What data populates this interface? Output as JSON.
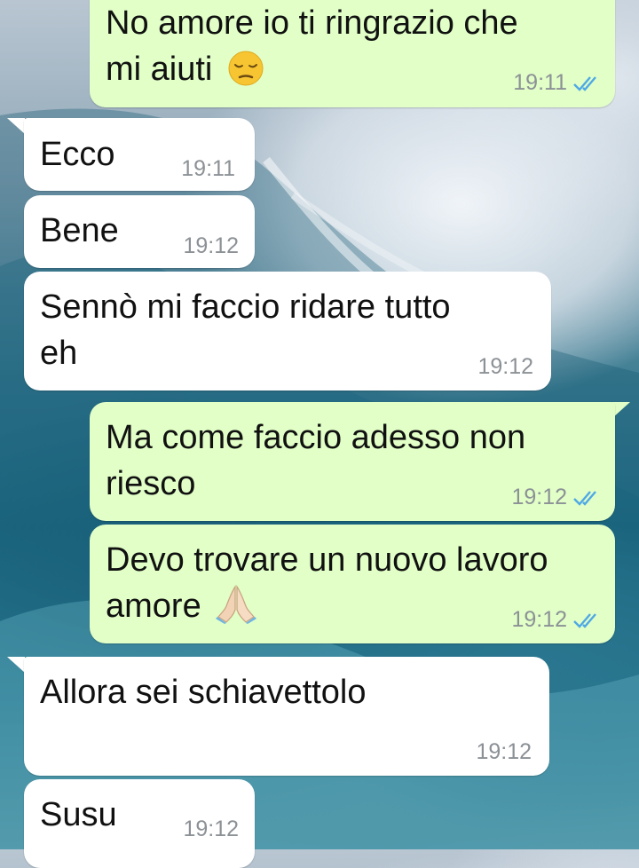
{
  "conversation": {
    "messages": [
      {
        "direction": "outgoing",
        "lines": [
          "No amore io ti ringrazio che",
          "mi aiuti"
        ],
        "emoji": "pensive-face-emoji",
        "time": "19:11",
        "status": "read"
      },
      {
        "direction": "incoming",
        "lines": [
          "Ecco"
        ],
        "time": "19:11"
      },
      {
        "direction": "incoming",
        "lines": [
          "Bene"
        ],
        "time": "19:12"
      },
      {
        "direction": "incoming",
        "lines": [
          "Sennò mi faccio ridare tutto",
          "eh"
        ],
        "time": "19:12"
      },
      {
        "direction": "outgoing",
        "lines": [
          "Ma come faccio adesso non",
          "riesco"
        ],
        "time": "19:12",
        "status": "read"
      },
      {
        "direction": "outgoing",
        "lines": [
          "Devo trovare un nuovo lavoro",
          "amore"
        ],
        "emoji": "folded-hands-emoji",
        "time": "19:12",
        "status": "read"
      },
      {
        "direction": "incoming",
        "lines": [
          "Allora sei schiavettolo"
        ],
        "time": "19:12"
      },
      {
        "direction": "incoming",
        "lines": [
          "Susu"
        ],
        "time": "19:12"
      }
    ]
  },
  "colors": {
    "incoming_bubble": "#ffffff",
    "outgoing_bubble": "#e1ffc7",
    "read_ticks": "#4fa8e6",
    "timestamp": "#8c9196"
  },
  "icons": {
    "read_receipt": "double-check-icon"
  }
}
